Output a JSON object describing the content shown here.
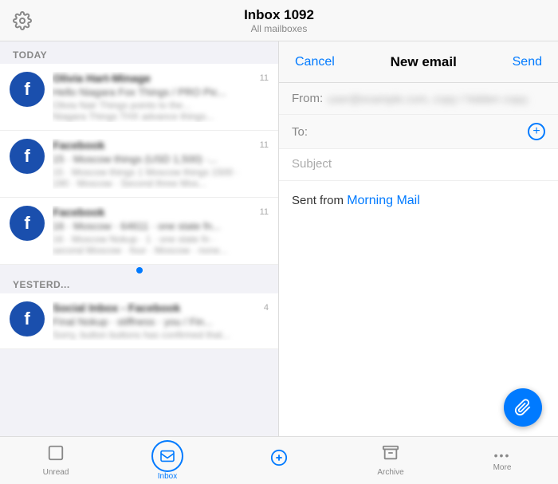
{
  "header": {
    "gear_label": "⚙",
    "inbox_title": "Inbox 1092",
    "inbox_subtitle": "All mailboxes"
  },
  "compose": {
    "cancel_label": "Cancel",
    "title": "New email",
    "send_label": "Send",
    "from_label": "From:",
    "from_value": "user@example.com, copy / hidden copy;",
    "to_label": "To:",
    "subject_placeholder": "Subject",
    "body_text": "Sent from ",
    "body_link": "Morning Mail"
  },
  "email_list": {
    "today_label": "TODAY",
    "yesterday_label": "YESTERD...",
    "emails_today": [
      {
        "sender": "Olivia Hart-Minage",
        "subject": "Hello Niagara Fox Things / PRO Pic...",
        "preview": "Olivia Nair Things points to the...",
        "preview2": "Niagara Things THX advance things...",
        "time": "11",
        "avatar_letter": "f",
        "unread": true
      },
      {
        "sender": "Facebook",
        "subject": "15 · Moscow things (USD 1,500) ·...",
        "preview": "15 · Moscow things 1 Moscow things 1500 ·",
        "preview2": "190 · Moscow · Second three Mos...",
        "time": "11",
        "avatar_letter": "f",
        "unread": true
      },
      {
        "sender": "Facebook",
        "subject": "16 · Moscow · 64611 · one state fn...",
        "preview": "16 · Moscow Nokup · 1 · one state fn ·",
        "preview2": "second Moscow · four · Moscow · none...",
        "time": "11",
        "avatar_letter": "f",
        "unread": true
      }
    ],
    "emails_yesterday": [
      {
        "sender": "Social Inbox - Facebook",
        "subject": "Final Nokup · stiffness · you / Fin...",
        "preview": "Sorry, button buttons has confirmed that...",
        "preview2": "",
        "time": "4",
        "avatar_letter": "f",
        "unread": false
      }
    ]
  },
  "tab_bar": {
    "items": [
      {
        "label": "Unread",
        "icon": "☐",
        "active": false
      },
      {
        "label": "Inbox",
        "icon": "✉",
        "active": true
      },
      {
        "label": "",
        "icon": "✏",
        "active": false
      },
      {
        "label": "Archive",
        "icon": "⊡",
        "active": false
      },
      {
        "label": "More",
        "icon": "•••",
        "active": false
      }
    ]
  },
  "fab": {
    "icon": "📎"
  }
}
